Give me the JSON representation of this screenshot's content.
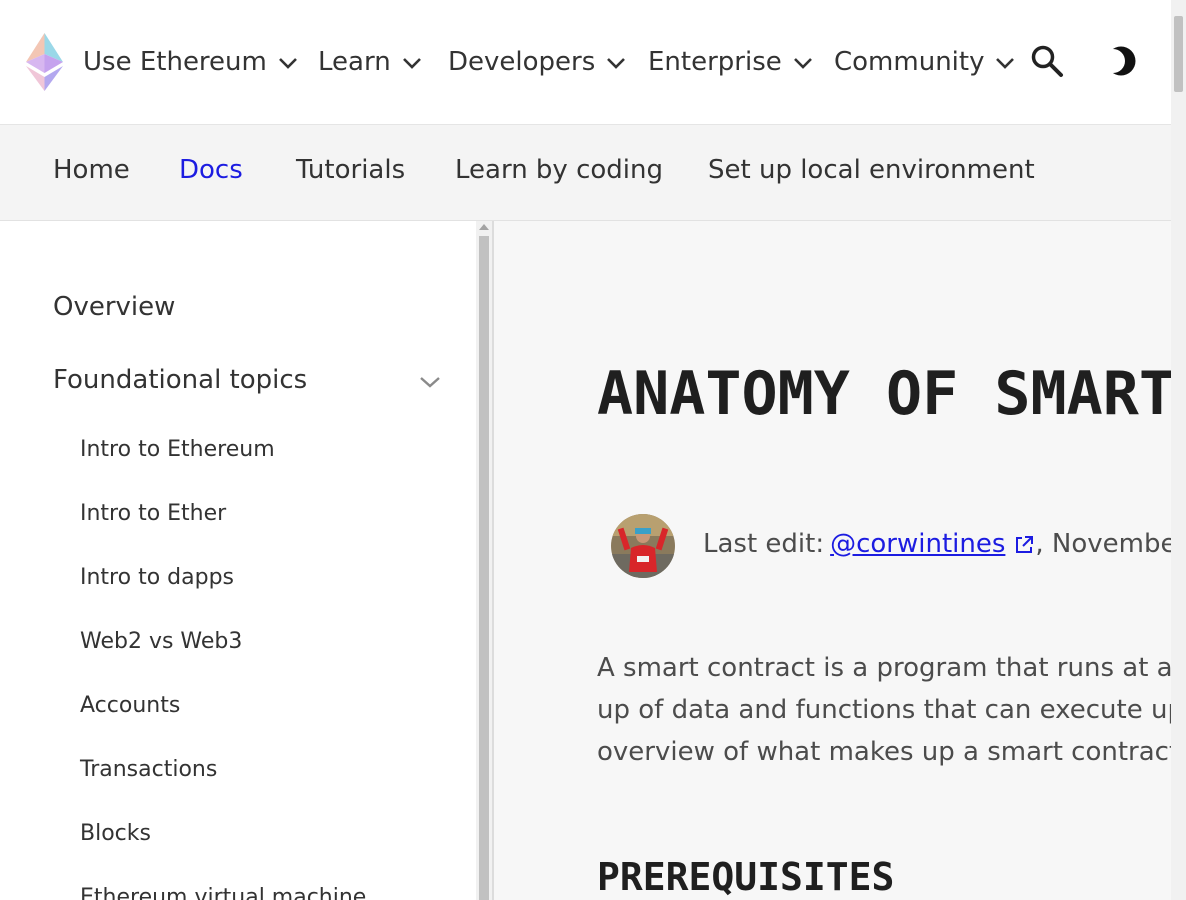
{
  "topnav": {
    "logo": "ethereum-logo-icon",
    "items": [
      {
        "label": "Use Ethereum"
      },
      {
        "label": "Learn"
      },
      {
        "label": "Developers"
      },
      {
        "label": "Enterprise"
      },
      {
        "label": "Community"
      }
    ],
    "search_icon": "search-icon",
    "theme_icon": "dark-mode-icon"
  },
  "subnav": {
    "items": [
      {
        "label": "Home",
        "active": false
      },
      {
        "label": "Docs",
        "active": true
      },
      {
        "label": "Tutorials",
        "active": false
      },
      {
        "label": "Learn by coding",
        "active": false
      },
      {
        "label": "Set up local environment",
        "active": false
      }
    ]
  },
  "sidebar": {
    "overview": "Overview",
    "section": "Foundational topics",
    "items": [
      {
        "label": "Intro to Ethereum"
      },
      {
        "label": "Intro to Ether"
      },
      {
        "label": "Intro to dapps"
      },
      {
        "label": "Web2 vs Web3"
      },
      {
        "label": "Accounts"
      },
      {
        "label": "Transactions"
      },
      {
        "label": "Blocks"
      },
      {
        "label": "Ethereum virtual machine"
      }
    ]
  },
  "main": {
    "title": "ANATOMY OF SMART CONTRACTS",
    "last_edit_label": "Last edit:",
    "author": "@corwintines",
    "edit_date": ", November",
    "intro_lines": [
      "A smart contract is a program that runs at an a",
      "up of data and functions that can execute upo",
      "overview of what makes up a smart contract."
    ],
    "section_heading": "PREREQUISITES"
  },
  "colors": {
    "accent": "#1c1ce1",
    "text": "#333333",
    "subnav_bg": "#f4f4f4",
    "main_bg": "#f7f7f7"
  }
}
